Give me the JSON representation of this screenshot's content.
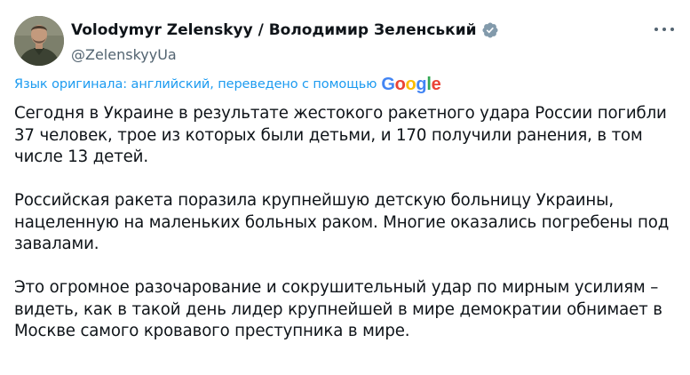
{
  "author": {
    "display_name": "Volodymyr Zelenskyy / Володимир Зеленський",
    "handle": "@ZelenskyyUa",
    "verified_icon": "verified-badge-icon",
    "more_icon": "more-options-icon"
  },
  "translation": {
    "note": "Язык оригинала: английский, переведено с помощью",
    "provider_logo": "Google"
  },
  "tweet": {
    "paragraphs": [
      "Сегодня в Украине в результате жестокого ракетного удара России погибли 37 человек, трое из которых были детьми, и 170 получили ранения, в том числе 13 детей.",
      "Российская ракета поразила крупнейшую детскую больницу Украины, нацеленную на маленьких больных раком. Многие оказались погребены под завалами.",
      "Это огромное разочарование и сокрушительный удар по мирным усилиям – видеть, как в такой день лидер крупнейшей в мире демократии обнимает в Москве самого кровавого преступника в мире."
    ]
  },
  "colors": {
    "text": "#0f1419",
    "secondary": "#536471",
    "link": "#1d9bf0",
    "verified_badge": "#829aab"
  }
}
